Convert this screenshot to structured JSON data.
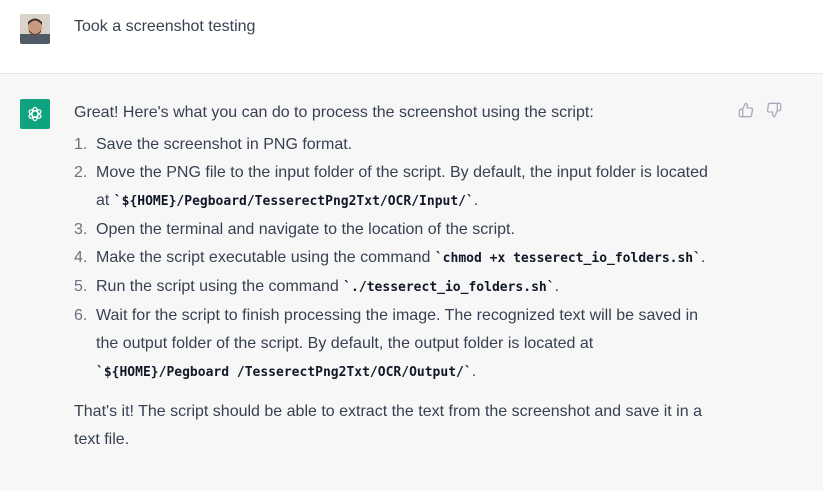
{
  "user": {
    "message": "Took a screenshot testing",
    "avatar_icon": "user-avatar-photo"
  },
  "assistant": {
    "logo_icon": "openai-logo-icon",
    "intro": "Great! Here's what you can do to process the screenshot using the script:",
    "steps": [
      {
        "num": "1.",
        "text": "Save the screenshot in PNG format."
      },
      {
        "num": "2.",
        "text": "Move the PNG file to the input folder of the script. By default, the input folder is located at ",
        "code": "`${HOME}/Pegboard/TesserectPng2Txt/OCR/Input/`",
        "tail": "."
      },
      {
        "num": "3.",
        "text": "Open the terminal and navigate to the location of the script."
      },
      {
        "num": "4.",
        "text": "Make the script executable using the command ",
        "code": "`chmod +x tesserect_io_folders.sh`",
        "tail": "."
      },
      {
        "num": "5.",
        "text": "Run the script using the command ",
        "code": "`./tesserect_io_folders.sh`",
        "tail": "."
      },
      {
        "num": "6.",
        "text": "Wait for the script to finish processing the image. The recognized text will be saved in the output folder of the script. By default, the output folder is located at ",
        "code": "`${HOME}/Pegboard /TesserectPng2Txt/OCR/Output/`",
        "tail": "."
      }
    ],
    "outro": "That's it! The script should be able to extract the text from the screenshot and save it in a text file.",
    "feedback": {
      "thumbs_up_icon": "thumbs-up-icon",
      "thumbs_down_icon": "thumbs-down-icon"
    }
  },
  "colors": {
    "brand": "#10a37f",
    "assistant_bg": "#f7f7f8",
    "text": "#374151"
  }
}
